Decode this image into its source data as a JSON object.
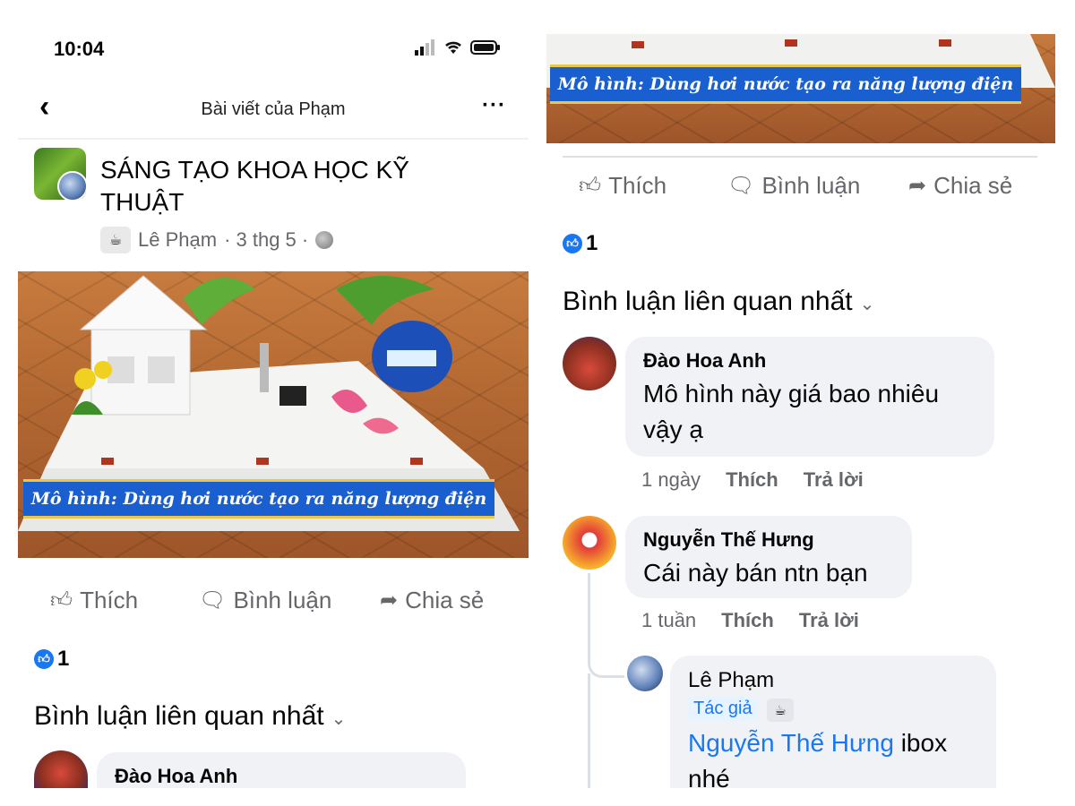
{
  "status": {
    "time": "10:04"
  },
  "header": {
    "back": "‹",
    "title": "Bài viết của Phạm",
    "more": "···"
  },
  "post": {
    "group": "SÁNG TẠO KHOA HỌC KỸ THUẬT",
    "author": "Lê Phạm",
    "date_sep": "· 3 thg 5 ·",
    "photo_caption": "Mô hình: Dùng hơi nước tạo ra năng lượng điện"
  },
  "actions": {
    "like": "Thích",
    "comment": "Bình luận",
    "share": "Chia sẻ"
  },
  "reactions": {
    "count": "1"
  },
  "comments_section": {
    "title": "Bình luận liên quan nhất"
  },
  "comments": [
    {
      "name": "Đào Hoa Anh",
      "text_line1": "Mô hình này giá bao nhiêu",
      "text_line2": "vậy ạ",
      "time": "1 ngày",
      "like": "Thích",
      "reply": "Trả lời"
    },
    {
      "name": "Nguyễn Thế Hưng",
      "text": "Cái này bán ntn bạn",
      "time": "1 tuần",
      "like": "Thích",
      "reply": "Trả lời"
    }
  ],
  "reply": {
    "name": "Lê Phạm",
    "badge": "Tác giả",
    "mention": "Nguyễn Thế Hưng",
    "text_after": " ibox",
    "text_line2": "nhé"
  }
}
